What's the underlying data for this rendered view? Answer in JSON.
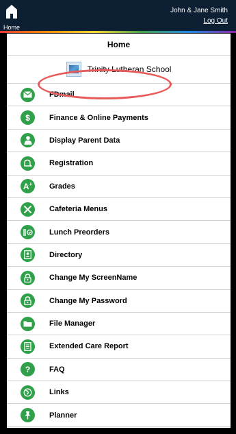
{
  "header": {
    "home_label": "Home",
    "user_name": "John & Jane Smith",
    "logout_label": "Log Out"
  },
  "page": {
    "title": "Home",
    "school_name": "Trinity Lutheran School"
  },
  "menu": [
    {
      "label": "FDmail",
      "icon": "mail-icon"
    },
    {
      "label": "Finance & Online Payments",
      "icon": "dollar-icon"
    },
    {
      "label": "Display Parent Data",
      "icon": "person-icon"
    },
    {
      "label": "Registration",
      "icon": "bell-plus-icon"
    },
    {
      "label": "Grades",
      "icon": "a-plus-icon"
    },
    {
      "label": "Cafeteria Menus",
      "icon": "utensils-icon"
    },
    {
      "label": "Lunch Preorders",
      "icon": "lunch-check-icon"
    },
    {
      "label": "Directory",
      "icon": "directory-icon"
    },
    {
      "label": "Change My ScreenName",
      "icon": "lock-icon"
    },
    {
      "label": "Change My Password",
      "icon": "lock-icon"
    },
    {
      "label": "File Manager",
      "icon": "folder-icon"
    },
    {
      "label": "Extended Care Report",
      "icon": "document-icon"
    },
    {
      "label": "FAQ",
      "icon": "question-icon"
    },
    {
      "label": "Links",
      "icon": "globe-icon"
    },
    {
      "label": "Planner",
      "icon": "pushpin-icon"
    }
  ],
  "colors": {
    "topbar": "#0d1f33",
    "icon_green": "#30a14a",
    "highlight": "#e85b5b"
  }
}
